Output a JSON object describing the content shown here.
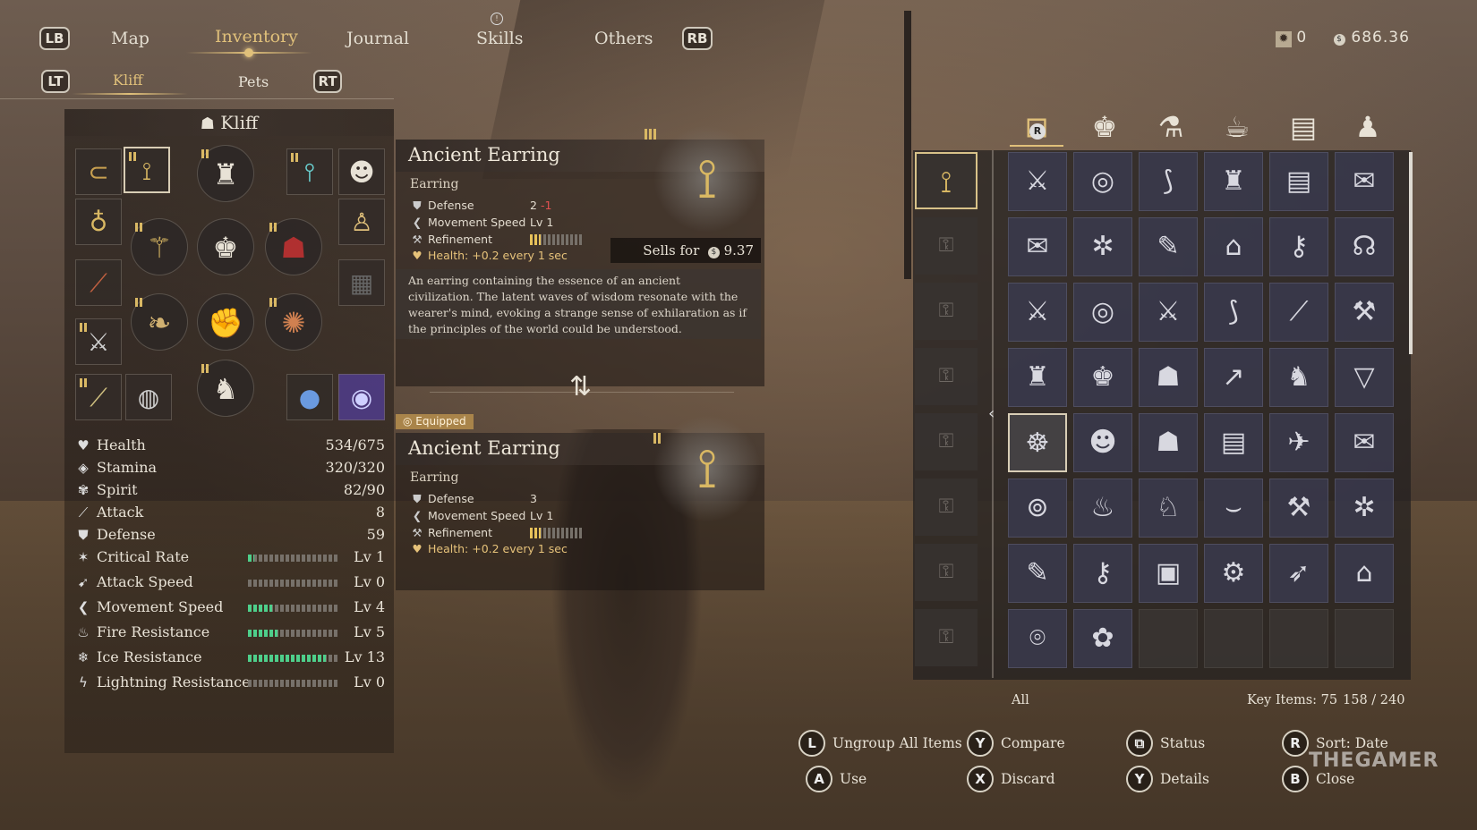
{
  "nav": {
    "lb": "LB",
    "rb": "RB",
    "lt": "LT",
    "rt": "RT",
    "tabs": [
      "Map",
      "Inventory",
      "Journal",
      "Skills",
      "Others"
    ],
    "subtabs": [
      "Kliff",
      "Pets"
    ]
  },
  "currency": {
    "icon_a": "sunburst-icon",
    "amount_a": "0",
    "icon_b": "coin-icon",
    "amount_b": "686.36"
  },
  "character": {
    "name": "Kliff",
    "stats": [
      {
        "icon": "heart-icon",
        "label": "Health",
        "value": "534/675"
      },
      {
        "icon": "stamina-icon",
        "label": "Stamina",
        "value": "320/320"
      },
      {
        "icon": "spirit-icon",
        "label": "Spirit",
        "value": "82/90"
      },
      {
        "icon": "sword-icon",
        "label": "Attack",
        "value": "8"
      },
      {
        "icon": "shield-icon",
        "label": "Defense",
        "value": "59"
      },
      {
        "icon": "critical-icon",
        "label": "Critical Rate",
        "value": "Lv 1",
        "level": 1,
        "max": 15
      },
      {
        "icon": "attack-speed-icon",
        "label": "Attack Speed",
        "value": "Lv 0",
        "level": 0,
        "max": 15
      },
      {
        "icon": "wing-icon",
        "label": "Movement Speed",
        "value": "Lv 4",
        "level": 4,
        "max": 15
      },
      {
        "icon": "flame-icon",
        "label": "Fire Resistance",
        "value": "Lv 5",
        "level": 5,
        "max": 15
      },
      {
        "icon": "snowflake-icon",
        "label": "Ice Resistance",
        "value": "Lv 13",
        "level": 13,
        "max": 15
      },
      {
        "icon": "lightning-icon",
        "label": "Lightning Resistance",
        "value": "Lv 0",
        "level": 0,
        "max": 15
      }
    ]
  },
  "selected_item": {
    "name": "Ancient Earring",
    "type": "Earring",
    "defense_label": "Defense",
    "defense_value": "2",
    "defense_diff": "-1",
    "move_label": "Movement Speed",
    "move_value": "Lv 1",
    "refine_label": "Refinement",
    "refinement_level": 2,
    "refinement_max": 10,
    "health_bonus": "Health: +0.2 every 1 sec",
    "sells_for_label": "Sells for",
    "sells_for_value": "9.37",
    "description": "An earring containing the essence of an ancient civilization. The latent waves of wisdom resonate with the wearer's mind, evoking a strange sense of exhilaration as if the principles of the world could be understood."
  },
  "equipped_item": {
    "badge": "Equipped",
    "name": "Ancient Earring",
    "type": "Earring",
    "defense_label": "Defense",
    "defense_value": "3",
    "move_label": "Movement Speed",
    "move_value": "Lv 1",
    "refine_label": "Refinement",
    "refinement_level": 2,
    "refinement_max": 10,
    "health_bonus": "Health: +0.2 every 1 sec"
  },
  "inventory": {
    "categories": [
      "equipment-bag-icon",
      "armor-icon",
      "potion-icon",
      "cooking-pot-icon",
      "scroll-icon",
      "sack-icon"
    ],
    "category_hint": "R",
    "filter": "All",
    "key_items_label": "Key Items: 75",
    "capacity": "158 / 240",
    "items": [
      "⚔",
      "◎",
      "⟆",
      "♜",
      "▤",
      "✉",
      "✉",
      "✲",
      "✎",
      "⌂",
      "⚷",
      "☊",
      "⚔",
      "◎",
      "⚔",
      "⟆",
      "⟋",
      "⚒",
      "♜",
      "♚",
      "☗",
      "↗",
      "♞",
      "▽",
      "☸",
      "☻",
      "☗",
      "▤",
      "✈",
      "✉",
      "⊚",
      "♨",
      "♘",
      "⌣",
      "⚒",
      "✲",
      "✎",
      "⚷",
      "▣",
      "⚙",
      "➶",
      "⌂",
      "⌾",
      "✿",
      "",
      "",
      "",
      ""
    ]
  },
  "prompts": [
    {
      "btn": "L",
      "label": "Ungroup All Items"
    },
    {
      "btn": "Y",
      "label": "Compare"
    },
    {
      "btn": "⧉",
      "label": "Status"
    },
    {
      "btn": "R",
      "label": "Sort: Date"
    },
    {
      "btn": "A",
      "label": "Use"
    },
    {
      "btn": "X",
      "label": "Discard"
    },
    {
      "btn": "Y",
      "label": "Details"
    },
    {
      "btn": "B",
      "label": "Close"
    }
  ],
  "watermark": "THEGAMER"
}
